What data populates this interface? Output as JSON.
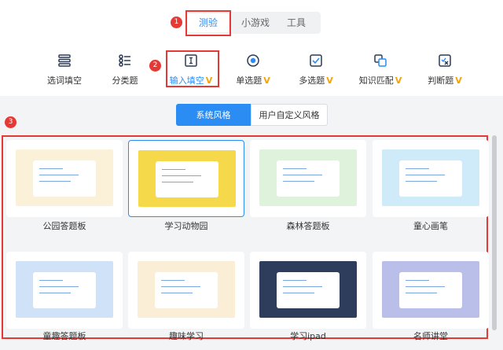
{
  "markers": [
    "1",
    "2",
    "3"
  ],
  "mode_tabs": [
    {
      "label": "测验",
      "active": true
    },
    {
      "label": "小游戏",
      "active": false
    },
    {
      "label": "工具",
      "active": false
    }
  ],
  "question_types": [
    {
      "label": "选词填空",
      "vip": "",
      "icon": "list-icon",
      "active": false
    },
    {
      "label": "分类题",
      "vip": "",
      "icon": "category-icon",
      "active": false
    },
    {
      "label": "输入填空",
      "vip": "V",
      "icon": "text-cursor-icon",
      "active": true
    },
    {
      "label": "单选题",
      "vip": "V",
      "icon": "radio-icon",
      "active": false
    },
    {
      "label": "多选题",
      "vip": "V",
      "icon": "checkbox-icon",
      "active": false
    },
    {
      "label": "知识匹配",
      "vip": "V",
      "icon": "match-icon",
      "active": false
    },
    {
      "label": "判断题",
      "vip": "V",
      "icon": "judge-icon",
      "active": false
    }
  ],
  "style_tabs": [
    {
      "label": "系统风格",
      "active": true
    },
    {
      "label": "用户自定义风格",
      "active": false
    }
  ],
  "templates": [
    {
      "label": "公园答题板",
      "selected": false,
      "bg": "#fbf1d8"
    },
    {
      "label": "学习动物园",
      "selected": true,
      "bg": "#f6d94a"
    },
    {
      "label": "森林答题板",
      "selected": false,
      "bg": "#dff2dc"
    },
    {
      "label": "童心画笔",
      "selected": false,
      "bg": "#cfeaf8"
    },
    {
      "label": "童趣答题板",
      "selected": false,
      "bg": "#cfe2f7"
    },
    {
      "label": "趣味学习",
      "selected": false,
      "bg": "#faefd6"
    },
    {
      "label": "学习ipad",
      "selected": false,
      "bg": "#2f3d5c"
    },
    {
      "label": "名师讲堂",
      "selected": false,
      "bg": "#b9bfe8"
    }
  ],
  "colors": {
    "accent": "#2b8cf3",
    "vip": "#f2a30b",
    "annotation": "#e53935"
  }
}
